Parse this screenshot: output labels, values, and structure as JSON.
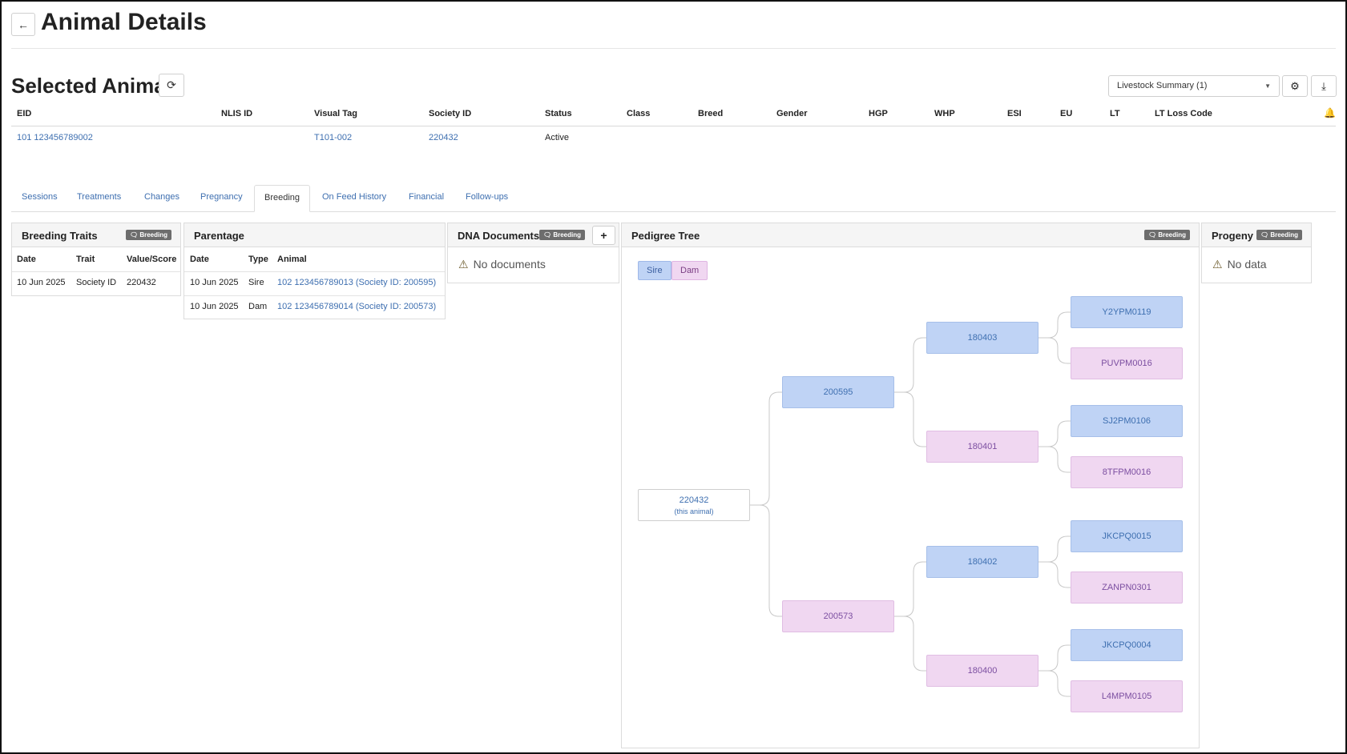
{
  "header": {
    "back_icon": "←",
    "title": "Animal Details"
  },
  "selected": {
    "title": "Selected Animal",
    "refresh_icon": "⟳"
  },
  "toolbar": {
    "summary_select": "Livestock Summary (1)",
    "settings_icon": "⚙",
    "download_icon": "⤓"
  },
  "animal_table": {
    "columns": [
      "EID",
      "NLIS ID",
      "Visual Tag",
      "Society ID",
      "Status",
      "Class",
      "Breed",
      "Gender",
      "HGP",
      "WHP",
      "ESI",
      "EU",
      "LT",
      "LT Loss Code"
    ],
    "row": {
      "eid": "101 123456789002",
      "visual_tag": "T101-002",
      "society_id": "220432",
      "status": "Active"
    }
  },
  "tabs": [
    "Sessions",
    "Treatments",
    "Changes",
    "Pregnancy",
    "Breeding",
    "On Feed History",
    "Financial",
    "Follow-ups"
  ],
  "active_tab": "Breeding",
  "breeding_badge": "Breeding",
  "breeding_traits": {
    "title": "Breeding Traits",
    "columns": [
      "Date",
      "Trait",
      "Value/Score"
    ],
    "rows": [
      {
        "date": "10 Jun 2025",
        "trait": "Society ID",
        "value": "220432"
      }
    ]
  },
  "parentage": {
    "title": "Parentage",
    "columns": [
      "Date",
      "Type",
      "Animal"
    ],
    "rows": [
      {
        "date": "10 Jun 2025",
        "type": "Sire",
        "animal": "102 123456789013 (Society ID: 200595)"
      },
      {
        "date": "10 Jun 2025",
        "type": "Dam",
        "animal": "102 123456789014 (Society ID: 200573)"
      }
    ]
  },
  "dna_documents": {
    "title": "DNA Documents",
    "add_label": "+",
    "empty": "No documents"
  },
  "pedigree": {
    "title": "Pedigree Tree",
    "legend": {
      "sire": "Sire",
      "dam": "Dam"
    },
    "self": {
      "id": "220432",
      "note": "(this animal)"
    },
    "parents": {
      "sire": "200595",
      "dam": "200573"
    },
    "grandparents": {
      "ss": "180403",
      "sd": "180401",
      "ds": "180402",
      "dd": "180400"
    },
    "great_grandparents": {
      "sss": "Y2YPM0119",
      "ssd": "PUVPM0016",
      "sds": "SJ2PM0106",
      "sdd": "8TFPM0016",
      "dss": "JKCPQ0015",
      "dsd": "ZANPN0301",
      "dds": "JKCPQ0004",
      "ddd": "L4MPM0105"
    }
  },
  "progeny": {
    "title": "Progeny",
    "empty": "No data"
  }
}
